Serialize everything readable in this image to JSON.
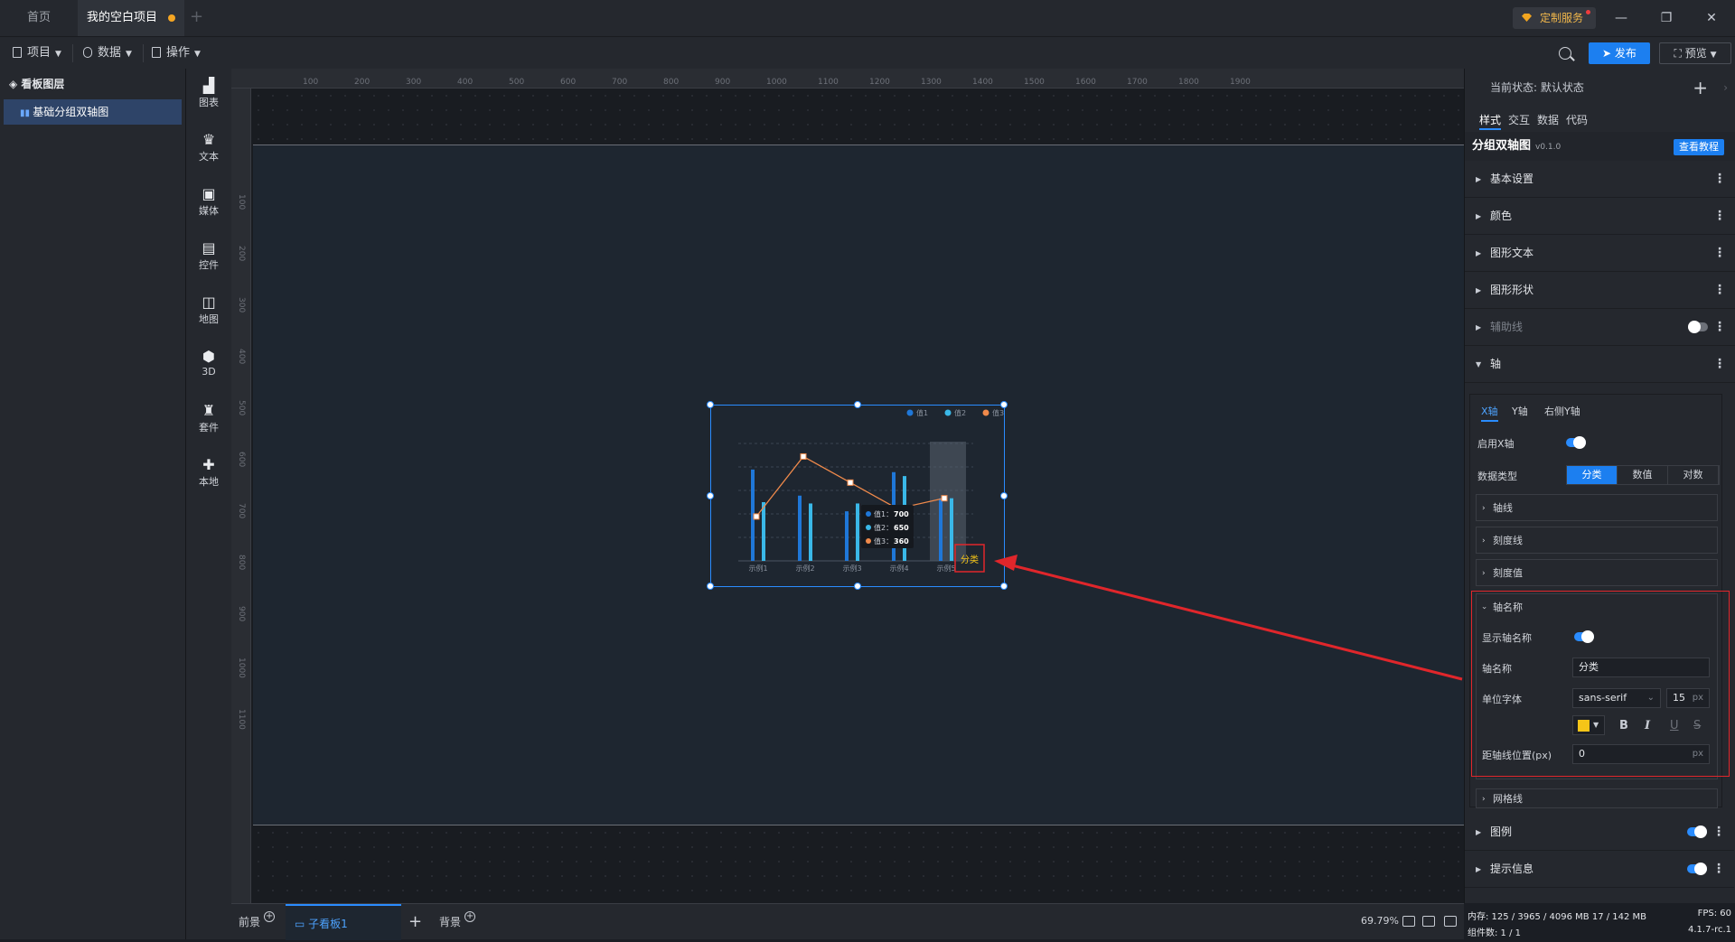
{
  "titlebar": {
    "tabs": [
      {
        "label": "首页"
      },
      {
        "label": "我的空白项目"
      }
    ],
    "custom_service": "定制服务"
  },
  "toolbar": {
    "project": "项目",
    "data": "数据",
    "operate": "操作",
    "publish": "发布",
    "preview": "预览"
  },
  "layers": {
    "title": "看板图层",
    "items": [
      {
        "label": "基础分组双轴图"
      }
    ]
  },
  "components": [
    {
      "label": "图表",
      "icon": "bar-chart-icon"
    },
    {
      "label": "文本",
      "icon": "text-icon"
    },
    {
      "label": "媒体",
      "icon": "media-icon"
    },
    {
      "label": "控件",
      "icon": "control-icon"
    },
    {
      "label": "地图",
      "icon": "map-icon"
    },
    {
      "label": "3D",
      "icon": "cube-icon"
    },
    {
      "label": "套件",
      "icon": "shirt-icon"
    },
    {
      "label": "本地",
      "icon": "puzzle-icon"
    }
  ],
  "ruler": {
    "top": [
      "100",
      "200",
      "300",
      "400",
      "500",
      "600",
      "700",
      "800",
      "900",
      "1000",
      "1100",
      "1200",
      "1300",
      "1400",
      "1500",
      "1600",
      "1700",
      "1800",
      "1900"
    ],
    "left": [
      "100",
      "200",
      "300",
      "400",
      "500",
      "600",
      "700",
      "800",
      "900",
      "1000",
      "1100"
    ]
  },
  "chart_data": {
    "type": "bar",
    "categories": [
      "示例1",
      "示例2",
      "示例3",
      "示例4",
      "示例5"
    ],
    "series": [
      {
        "name": "值1",
        "values": [
          700,
          500,
          380,
          680,
          480
        ],
        "kind": "bar",
        "color": "#1f77d8"
      },
      {
        "name": "值2",
        "values": [
          450,
          440,
          440,
          650,
          480
        ],
        "kind": "bar",
        "color": "#3ab8e8"
      },
      {
        "name": "值3",
        "values": [
          340,
          800,
          600,
          400,
          480
        ],
        "kind": "line",
        "color": "#f08a4b"
      }
    ],
    "axis_name": "分类",
    "axis_name_color": "#f5c518",
    "tooltip": {
      "items": [
        {
          "label": "值1：",
          "value": "700"
        },
        {
          "label": "值2：",
          "value": "650"
        },
        {
          "label": "值3：",
          "value": "360"
        }
      ]
    },
    "ylim": [
      0,
      900
    ],
    "legend_position": "top-right",
    "grid": true,
    "highlight_category": "示例5"
  },
  "bottom": {
    "foreground": "前景",
    "subboard": "子看板1",
    "background": "背景",
    "zoom": "69.79%"
  },
  "panel": {
    "state_label": "当前状态:  默认状态",
    "tabs": [
      "样式",
      "交互",
      "数据",
      "代码"
    ],
    "component_name": "分组双轴图",
    "version": "v0.1.0",
    "tutorial": "查看教程",
    "sections": [
      "基本设置",
      "颜色",
      "图形文本",
      "图形形状",
      "辅助线",
      "轴"
    ],
    "axis_tabs": [
      "X轴",
      "Y轴",
      "右侧Y轴"
    ],
    "enable_x": "启用X轴",
    "data_type_label": "数据类型",
    "data_types": [
      "分类",
      "数值",
      "对数"
    ],
    "sub_sections": [
      "轴线",
      "刻度线",
      "刻度值"
    ],
    "axis_name_section": "轴名称",
    "show_axis_name": "显示轴名称",
    "axis_name_label": "轴名称",
    "axis_name_value": "分类",
    "font_label": "单位字体",
    "font_value": "sans-serif",
    "font_size": "15",
    "unit_px": "px",
    "font_color": "#f5c518",
    "distance_label": "距轴线位置(px)",
    "distance_value": "0",
    "grid_section": "网格线",
    "legend_section": "图例",
    "tooltip_section": "提示信息"
  },
  "status": {
    "memory": "内存:  125 / 3965 / 4096 MB  17 / 142 MB",
    "fps": "FPS:  60",
    "components": "组件数: 1 / 1",
    "version": "4.1.7-rc.1"
  }
}
